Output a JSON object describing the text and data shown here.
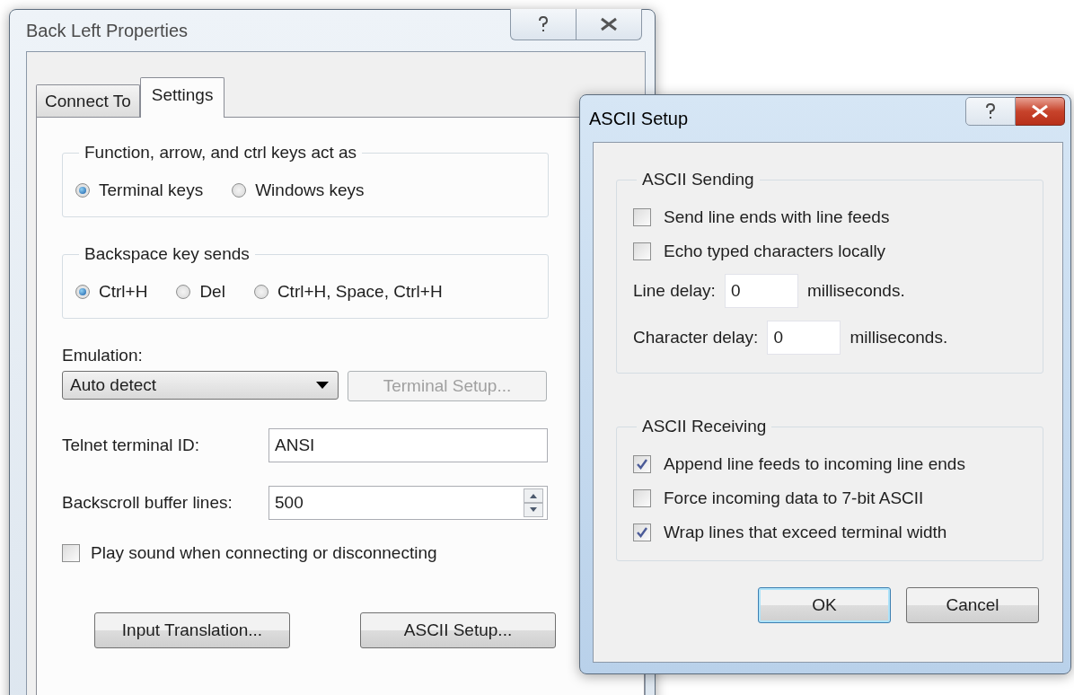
{
  "properties_dialog": {
    "title": "Back Left Properties",
    "active": false,
    "tabs": [
      {
        "label": "Connect To",
        "selected": false
      },
      {
        "label": "Settings",
        "selected": true
      }
    ],
    "groups": [
      {
        "title": "Function, arrow, and ctrl keys act as",
        "options": [
          {
            "label": "Terminal keys",
            "selected": true
          },
          {
            "label": "Windows keys",
            "selected": false
          }
        ]
      },
      {
        "title": "Backspace key sends",
        "options": [
          {
            "label": "Ctrl+H",
            "selected": true
          },
          {
            "label": "Del",
            "selected": false
          },
          {
            "label": "Ctrl+H, Space, Ctrl+H",
            "selected": false
          }
        ]
      }
    ],
    "emulation": {
      "label": "Emulation:",
      "value": "Auto detect"
    },
    "terminal_setup_button": {
      "label": "Terminal Setup...",
      "disabled": true
    },
    "fields": [
      {
        "label": "Telnet terminal ID:",
        "value": "ANSI",
        "kind": "text"
      },
      {
        "label": "Backscroll buffer lines:",
        "value": "500",
        "kind": "spin"
      }
    ],
    "play_sound": {
      "label": "Play sound when connecting or disconnecting",
      "checked": false
    },
    "buttons": [
      "Input Translation...",
      "ASCII Setup..."
    ]
  },
  "ascii_setup_dialog": {
    "title": "ASCII Setup",
    "active": true,
    "sending": {
      "title": "ASCII Sending",
      "checkboxes": [
        {
          "label": "Send line ends with line feeds",
          "checked": false
        },
        {
          "label": "Echo typed characters locally",
          "checked": false
        }
      ],
      "delays": [
        {
          "label": "Line delay:",
          "value": "0",
          "unit": "milliseconds."
        },
        {
          "label": "Character delay:",
          "value": "0",
          "unit": "milliseconds."
        }
      ]
    },
    "receiving": {
      "title": "ASCII Receiving",
      "checkboxes": [
        {
          "label": "Append line feeds to incoming line ends",
          "checked": true
        },
        {
          "label": "Force incoming data to 7-bit ASCII",
          "checked": false
        },
        {
          "label": "Wrap lines that exceed terminal width",
          "checked": true
        }
      ]
    },
    "buttons": [
      {
        "label": "OK",
        "default": true
      },
      {
        "label": "Cancel",
        "default": false
      }
    ]
  }
}
